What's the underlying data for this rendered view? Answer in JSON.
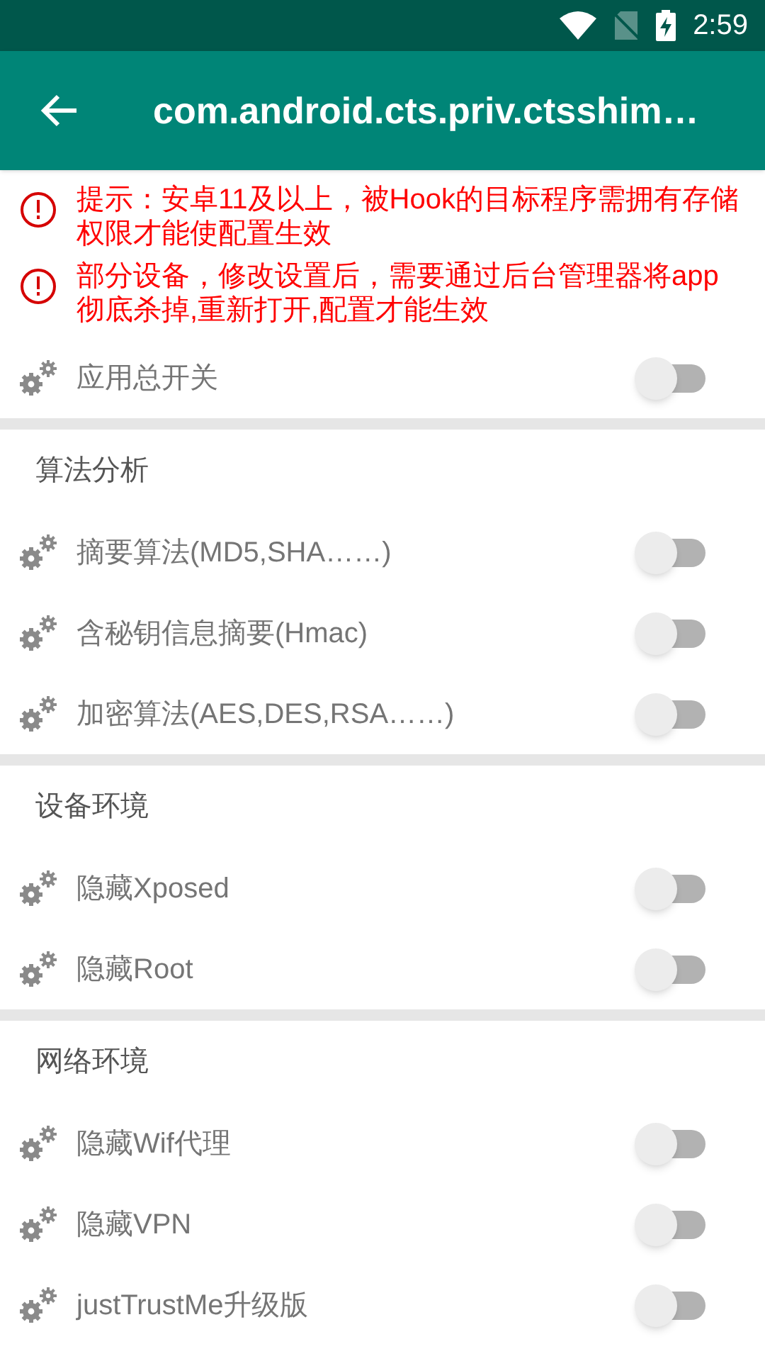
{
  "status_bar": {
    "time": "2:59"
  },
  "toolbar": {
    "title": "com.android.cts.priv.ctsshim…"
  },
  "notices": [
    {
      "text": "提示：安卓11及以上，被Hook的目标程序需拥有存储权限才能使配置生效"
    },
    {
      "text": "部分设备，修改设置后，需要通过后台管理器将app彻底杀掉,重新打开,配置才能生效"
    }
  ],
  "groups": [
    {
      "items": [
        {
          "label": "应用总开关",
          "on": false
        }
      ]
    },
    {
      "header": "算法分析",
      "items": [
        {
          "label": "摘要算法(MD5,SHA……)",
          "on": false
        },
        {
          "label": "含秘钥信息摘要(Hmac)",
          "on": false
        },
        {
          "label": "加密算法(AES,DES,RSA……)",
          "on": false
        }
      ]
    },
    {
      "header": "设备环境",
      "items": [
        {
          "label": "隐藏Xposed",
          "on": false
        },
        {
          "label": "隐藏Root",
          "on": false
        }
      ]
    },
    {
      "header": "网络环境",
      "items": [
        {
          "label": "隐藏Wif代理",
          "on": false
        },
        {
          "label": "隐藏VPN",
          "on": false
        },
        {
          "label": "justTrustMe升级版",
          "on": false
        }
      ]
    }
  ]
}
